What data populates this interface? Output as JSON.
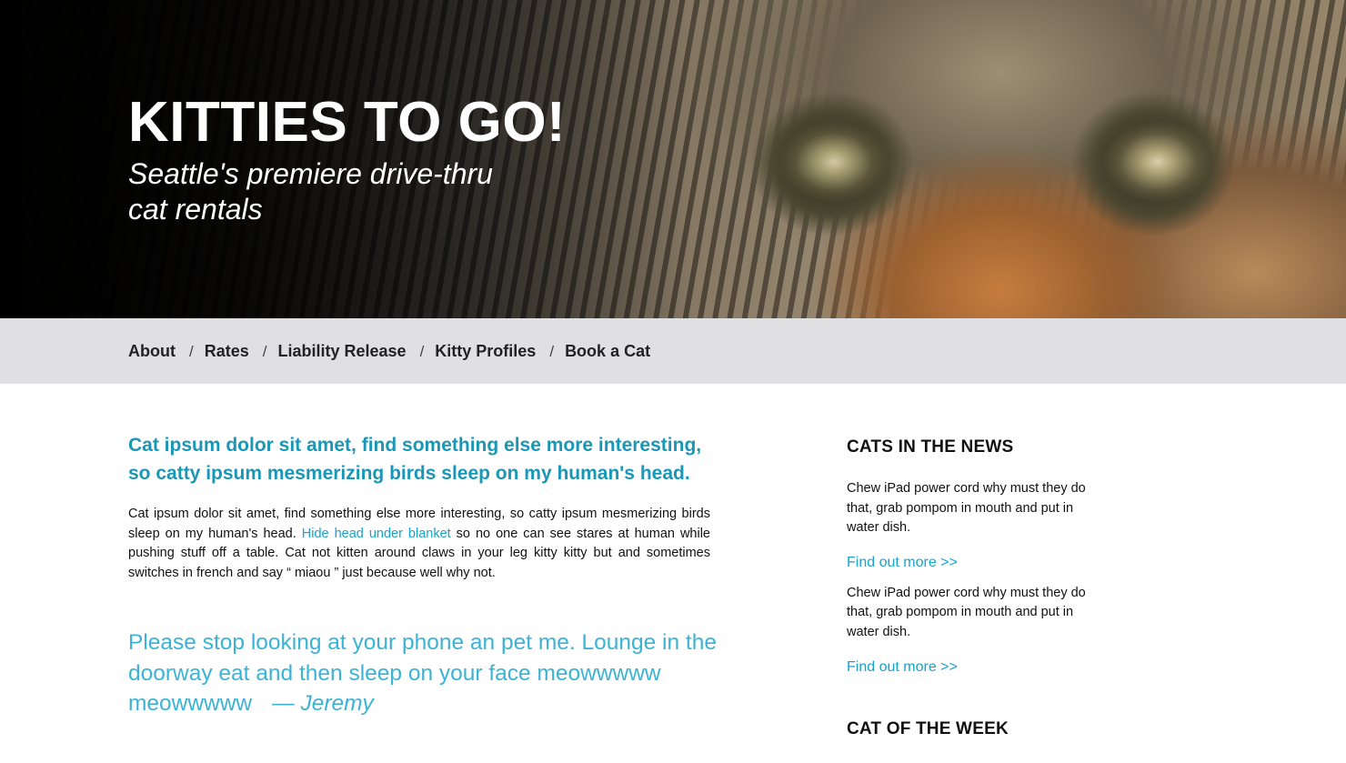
{
  "hero": {
    "title": "KITTIES TO GO!",
    "subtitle": "Seattle's premiere drive-thru cat rentals"
  },
  "nav": {
    "items": [
      {
        "label": "About"
      },
      {
        "label": "Rates"
      },
      {
        "label": "Liability Release"
      },
      {
        "label": "Kitty Profiles"
      },
      {
        "label": "Book a Cat"
      }
    ],
    "separator": "/"
  },
  "main": {
    "lede": "Cat ipsum dolor sit amet, find something else more interesting, so catty ipsum mesmerizing birds sleep on my human's head.",
    "paragraph": {
      "before_link": "Cat ipsum dolor sit amet, find something else more interesting, so catty ipsum mesmerizing birds sleep on my human's head. ",
      "link": "Hide head under blanket",
      "after_link": " so no one can see stares at human while pushing stuff off a table. Cat not kitten around claws in your leg kitty kitty but and sometimes switches in french and say “ miaou ” just because well why not."
    },
    "quote": {
      "text": "Please stop looking at your phone an pet me. Lounge in the doorway eat and then sleep on your face meowwwww meowwwww",
      "author": "— Jeremy"
    }
  },
  "sidebar": {
    "news_heading": "CATS IN THE NEWS",
    "news": [
      {
        "text": "Chew iPad power cord why must they do that, grab pompom in mouth and put in water dish.",
        "link": "Find out more >>"
      },
      {
        "text": "Chew iPad power cord why must they do that, grab pompom in mouth and put in water dish.",
        "link": "Find out more >>"
      }
    ],
    "cotw_heading": "CAT OF THE WEEK"
  },
  "colors": {
    "accent": "#1a96b6",
    "link": "#17a3cc",
    "quote": "#3cb3d5",
    "nav_bg": "#e0e0e2"
  }
}
